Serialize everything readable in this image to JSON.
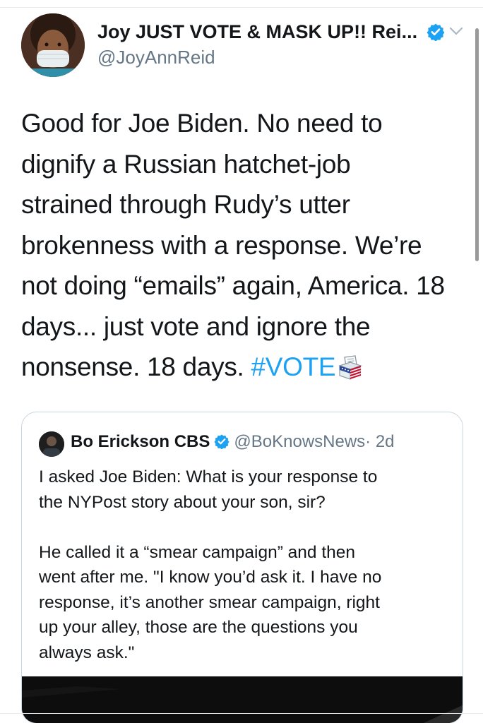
{
  "tweet": {
    "author": {
      "display_name": "Joy JUST VOTE & MASK UP!! Rei...",
      "handle": "@JoyAnnReid"
    },
    "text_lines": [
      "Good for Joe Biden. No need to",
      "dignify a Russian hatchet-job",
      "strained through Rudy’s utter",
      "brokenness with a response. We’re",
      "not doing “emails” again, America. 18",
      "days... just vote and ignore the"
    ],
    "last_line_text": "nonsense. 18 days. ",
    "hashtag": "#VOTE",
    "icons": {
      "verified": "verified-badge-icon",
      "menu": "chevron-down-icon",
      "emoji": "ballot-box-icon"
    }
  },
  "quoted_tweet": {
    "author": {
      "display_name": "Bo Erickson CBS",
      "handle": "@BoKnowsNews",
      "time": "· 2d"
    },
    "paragraph1_lines": [
      "I asked Joe Biden: What is your response to",
      "the NYPost story about your son, sir?"
    ],
    "paragraph2_lines": [
      "He called it a “smear campaign” and then",
      "went after me. \"I know you’d ask it. I have no",
      "response, it’s another smear campaign, right",
      "up your alley, those are the questions you",
      "always ask.\""
    ]
  },
  "colors": {
    "accent": "#1da1f2",
    "text": "#14171a",
    "secondary_text": "#657786",
    "border": "#ccd6dd"
  }
}
